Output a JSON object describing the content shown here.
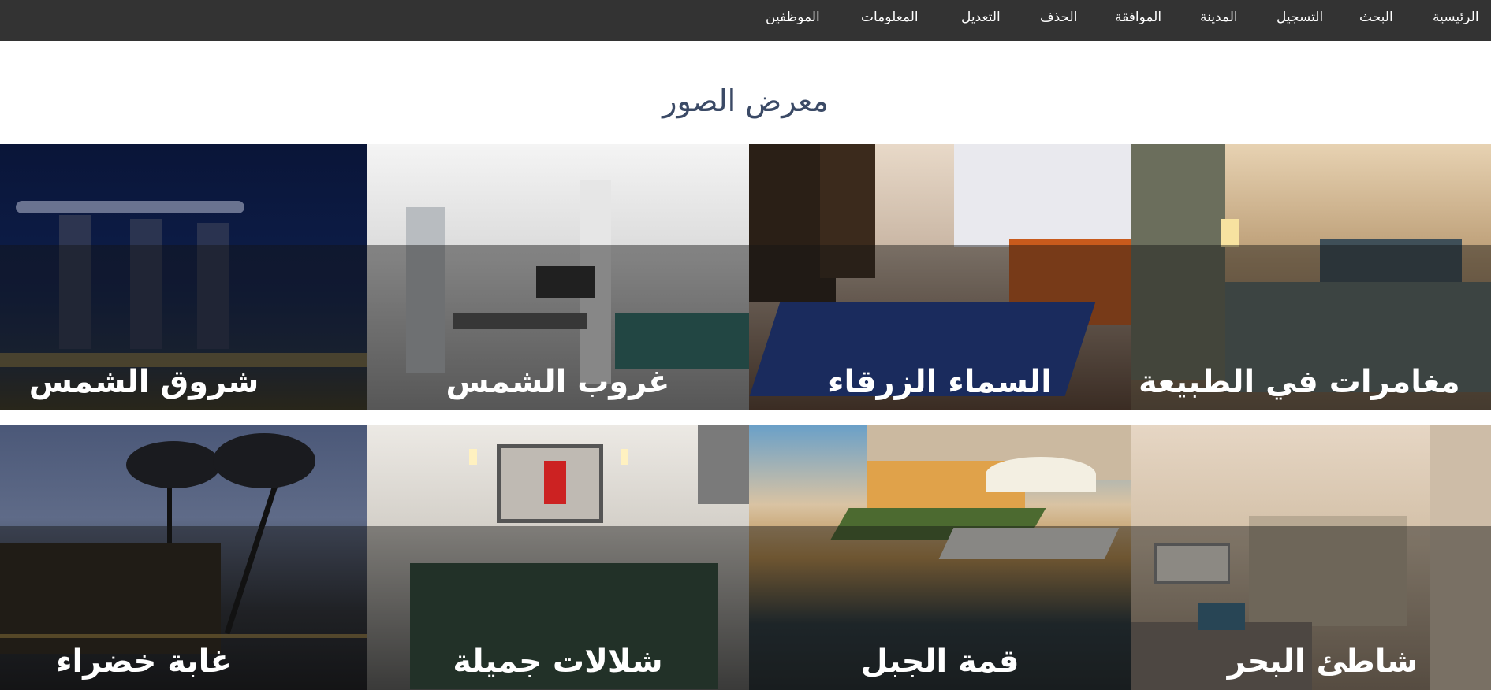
{
  "nav": {
    "items": [
      "الرئيسية",
      "البحث",
      "التسجيل",
      "المدينة",
      "الموافقة",
      "الحذف",
      "التعديل",
      "المعلومات",
      "الموظفين"
    ]
  },
  "title": "معرض الصور",
  "gallery": {
    "row1": [
      "شروق الشمس",
      "غروب الشمس",
      "السماء الزرقاء",
      "مغامرات في الطبيعة"
    ],
    "row2": [
      "غابة خضراء",
      "شلالات جميلة",
      "قمة الجبل",
      "شاطئ البحر"
    ]
  },
  "colors": {
    "navbar": "#333333",
    "title": "#3b4a66",
    "caption": "#ffffff"
  }
}
